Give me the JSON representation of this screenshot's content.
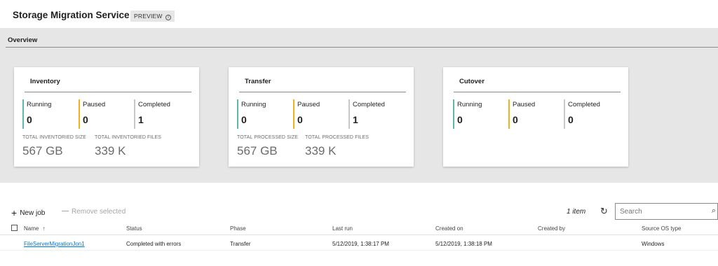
{
  "header": {
    "title": "Storage Migration Service",
    "badge": "PREVIEW"
  },
  "overview": {
    "title": "Overview",
    "cards": [
      {
        "title": "Inventory",
        "stats": [
          {
            "label": "Running",
            "value": "0",
            "color": "#5fb8b0"
          },
          {
            "label": "Paused",
            "value": "0",
            "color": "#f2b21a"
          },
          {
            "label": "Completed",
            "value": "1",
            "color": "#c8c8c8"
          }
        ],
        "sizes": [
          {
            "label": "TOTAL INVENTORIED SIZE",
            "value": "567 GB"
          },
          {
            "label": "TOTAL INVENTORIED FILES",
            "value": "339 K"
          }
        ]
      },
      {
        "title": "Transfer",
        "stats": [
          {
            "label": "Running",
            "value": "0",
            "color": "#5fb8b0"
          },
          {
            "label": "Paused",
            "value": "0",
            "color": "#f2b21a"
          },
          {
            "label": "Completed",
            "value": "1",
            "color": "#c8c8c8"
          }
        ],
        "sizes": [
          {
            "label": "TOTAL PROCESSED SIZE",
            "value": "567 GB"
          },
          {
            "label": "TOTAL PROCESSED FILES",
            "value": "339 K"
          }
        ]
      },
      {
        "title": "Cutover",
        "stats": [
          {
            "label": "Running",
            "value": "0",
            "color": "#5fb8b0"
          },
          {
            "label": "Paused",
            "value": "0",
            "color": "#f2b21a"
          },
          {
            "label": "Completed",
            "value": "0",
            "color": "#c8c8c8"
          }
        ]
      }
    ]
  },
  "toolbar": {
    "new_job": "New job",
    "remove_selected": "Remove selected",
    "item_count": "1 item",
    "search_placeholder": "Search"
  },
  "table": {
    "columns": [
      "Name",
      "Status",
      "Phase",
      "Last run",
      "Created on",
      "Created by",
      "Source OS type"
    ],
    "rows": [
      [
        "FileServerMigrationJon1",
        "Completed with errors",
        "Transfer",
        "5/12/2019, 1:38:17 PM",
        "5/12/2019, 1:38:18 PM",
        "",
        "Windows"
      ]
    ]
  },
  "icons": {
    "info": "info-icon",
    "plus": "plus-icon",
    "refresh": "refresh-icon",
    "search": "search-icon",
    "sort": "sort-ascending-icon"
  },
  "colors": {
    "link": "#0078d4",
    "running": "#5fb8b0",
    "paused": "#f2b21a",
    "completed": "#c8c8c8",
    "overview_bg": "#e6e6e6"
  }
}
